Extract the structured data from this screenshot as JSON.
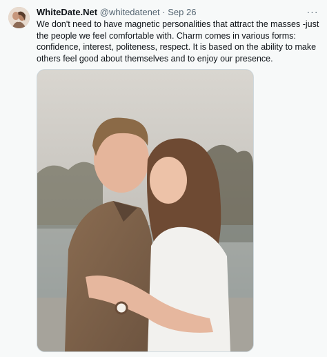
{
  "tweet": {
    "author_name": "WhiteDate.Net",
    "handle": "@whitedatenet",
    "separator": "·",
    "date": "Sep 26",
    "more_label": "···",
    "text": "We don't need to have magnetic personalities that attract the masses -just the people we feel comfortable with. Charm comes in various forms: confidence, interest, politeness, respect. It is based on the ability to make others feel good about themselves and to enjoy our presence."
  },
  "icons": {
    "more": "ellipsis-icon",
    "avatar": "profile-avatar"
  }
}
